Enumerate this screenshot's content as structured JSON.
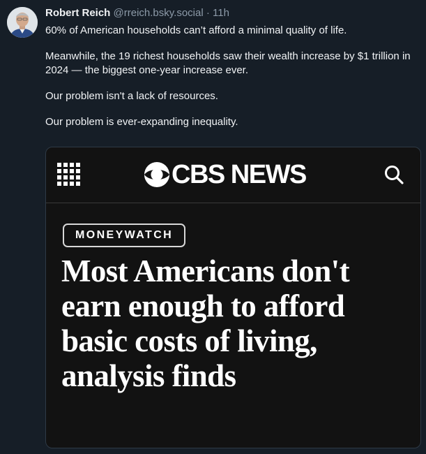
{
  "post": {
    "author_name": "Robert Reich",
    "handle": "@rreich.bsky.social",
    "separator": "·",
    "time": "11h",
    "paragraphs": [
      "60% of American households can’t afford a minimal quality of life.",
      "Meanwhile, the 19 richest households saw their wealth increase by $1 trillion in 2024 — the biggest one-year increase ever.",
      "Our problem isn't a lack of resources.",
      "Our problem is ever-expanding inequality."
    ]
  },
  "embed": {
    "site_name": "CBS NEWS",
    "section_badge": "MONEYWATCH",
    "headline": "Most Americans don't earn enough to afford basic costs of living, analysis finds",
    "icons": {
      "menu": "grid-menu-icon",
      "search": "search-icon",
      "logo": "cbs-eye-icon"
    }
  },
  "colors": {
    "background": "#161e27",
    "card_background": "#121212",
    "muted_text": "#8c9aa8"
  }
}
